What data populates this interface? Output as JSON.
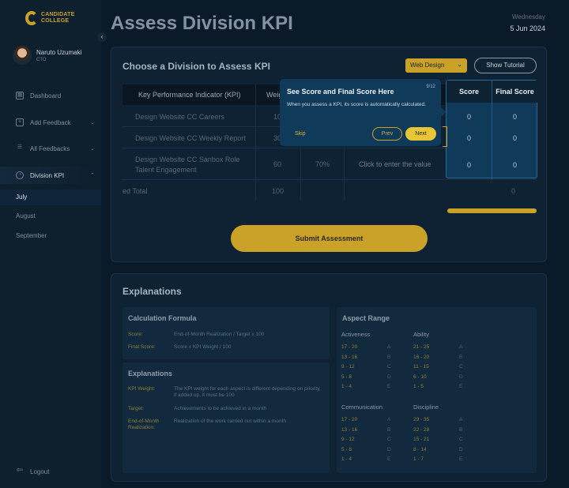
{
  "app": {
    "logo_line1": "CANDIDATE",
    "logo_line2": "COLLEGE",
    "brand_color": "#c9a227"
  },
  "profile": {
    "name": "Naruto Uzumaki",
    "role": "CTO"
  },
  "sidebar": {
    "items": [
      {
        "label": "Dashboard",
        "icon": "dashboard-icon"
      },
      {
        "label": "Add Feedback",
        "icon": "add-icon"
      },
      {
        "label": "All Feedbacks",
        "icon": "list-icon"
      },
      {
        "label": "Division KPI",
        "icon": "chart-icon"
      }
    ],
    "sub_items": [
      "July",
      "August",
      "September"
    ],
    "logout": "Logout"
  },
  "header": {
    "title": "Assess Division KPI",
    "day": "Wednesday",
    "date": "5 Jun 2024"
  },
  "assess": {
    "title": "Choose a Division to Assess KPI",
    "division": "Web Design",
    "tutorial_label": "Show Tutorial",
    "columns": {
      "kpi": "Key Performance Indicator (KPI)",
      "weight": "Weig",
      "score": "Score",
      "final": "Final Score"
    },
    "rows": [
      {
        "kpi": "Design Website CC Careers",
        "weight": "10",
        "score": "0",
        "final": "0"
      },
      {
        "kpi": "Design Website CC Weekly Report",
        "weight": "30",
        "score": "0",
        "final": "0"
      },
      {
        "kpi": "Design Website CC Sanbox Role Talent Engagement",
        "weight": "60",
        "target": "70%",
        "input_placeholder": "Click to enter the value",
        "score": "0",
        "final": "0"
      }
    ],
    "total_label": "ed Total",
    "total_weight": "100",
    "total_final": "0",
    "submit_label": "Submit Assessment"
  },
  "tooltip": {
    "title": "See Score and Final Score Here",
    "step": "9/12",
    "body": "When you assess a KPI, its score is automatically calculated.",
    "skip": "Skip",
    "prev": "Prev",
    "next": "Next"
  },
  "explanations": {
    "title": "Explanations",
    "calc": {
      "title": "Calculation Formula",
      "score_key": "Score:",
      "score_val": "End-of-Month Realization / Target x 100",
      "final_key": "Final Score:",
      "final_val": "Score x KPI Weight / 100"
    },
    "expl": {
      "title": "Explanations",
      "kpi_key": "KPI Weight:",
      "kpi_val": "The KPI weight for each aspect is different depending on priority, if added up, it must be 100",
      "target_key": "Target:",
      "target_val": "Achievements to be achieved in a month",
      "eom_key": "End-of-Month Realization:",
      "eom_val": "Realization of the work carried out within a month"
    },
    "range": {
      "title": "Aspect Range",
      "groups": [
        {
          "name": "Activeness",
          "ranges": [
            "17 - 20",
            "13 - 16",
            "9 - 12",
            "5 - 8",
            "1 - 4"
          ]
        },
        {
          "name": "Ability",
          "ranges": [
            "21 - 25",
            "16 - 20",
            "11 - 15",
            "6 - 10",
            "1 - 5"
          ]
        },
        {
          "name": "Communication",
          "ranges": [
            "17 - 20",
            "13 - 16",
            "9 - 12",
            "5 - 8",
            "1 - 4"
          ]
        },
        {
          "name": "Discipline",
          "ranges": [
            "29 - 35",
            "22 - 28",
            "15 - 21",
            "8 - 14",
            "1 - 7"
          ]
        }
      ],
      "grades": [
        "A",
        "B",
        "C",
        "D",
        "E"
      ]
    }
  }
}
